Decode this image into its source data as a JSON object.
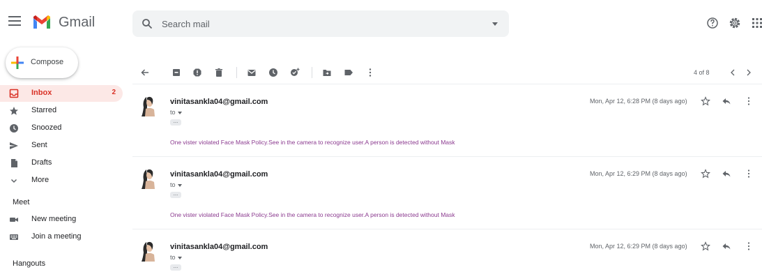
{
  "app": {
    "name": "Gmail"
  },
  "search": {
    "placeholder": "Search mail"
  },
  "compose": {
    "label": "Compose"
  },
  "nav": {
    "items": [
      {
        "label": "Inbox",
        "count": "2"
      },
      {
        "label": "Starred"
      },
      {
        "label": "Snoozed"
      },
      {
        "label": "Sent"
      },
      {
        "label": "Drafts"
      },
      {
        "label": "More"
      }
    ]
  },
  "meet": {
    "title": "Meet",
    "new_meeting": "New meeting",
    "join_meeting": "Join a meeting"
  },
  "hangouts": {
    "title": "Hangouts"
  },
  "toolbar": {
    "pager": "4 of 8"
  },
  "messages": [
    {
      "sender": "vinitasankla04@gmail.com",
      "to": "to",
      "date": "Mon, Apr 12, 6:28 PM (8 days ago)",
      "body": "One vister violated Face Mask Policy.See in the camera to recognize user.A person is detected without Mask"
    },
    {
      "sender": "vinitasankla04@gmail.com",
      "to": "to",
      "date": "Mon, Apr 12, 6:29 PM (8 days ago)",
      "body": "One vister violated Face Mask Policy.See in the camera to recognize user.A person is detected without Mask"
    },
    {
      "sender": "vinitasankla04@gmail.com",
      "to": "to",
      "date": "Mon, Apr 12, 6:29 PM (8 days ago)",
      "body": ""
    }
  ],
  "colors": {
    "brand_red": "#ea4335",
    "active_bg": "#fce8e6",
    "body_text": "#8b3a8f",
    "icon": "#5f6368"
  },
  "icons": {
    "header": [
      "menu-icon",
      "gmail-logo-icon",
      "search-icon",
      "help-icon",
      "settings-icon",
      "apps-icon"
    ],
    "toolbar": [
      "back-icon",
      "archive-icon",
      "report-spam-icon",
      "delete-icon",
      "mark-unread-icon",
      "snooze-icon",
      "add-to-tasks-icon",
      "move-to-icon",
      "labels-icon",
      "more-icon",
      "older-icon",
      "newer-icon"
    ]
  }
}
